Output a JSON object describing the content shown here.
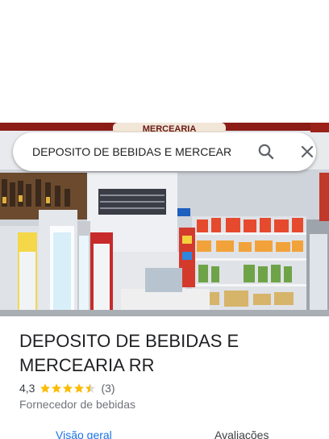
{
  "search": {
    "query": "DEPOSITO DE BEBIDAS E MERCEAR"
  },
  "photo": {
    "sign_text": "MERCEARIA"
  },
  "place": {
    "title": "DEPOSITO DE BEBIDAS E MERCEARIA RR",
    "rating": "4,3",
    "stars": 4.3,
    "review_count": "(3)",
    "category": "Fornecedor de bebidas"
  },
  "tabs": [
    {
      "label": "Visão geral"
    },
    {
      "label": "Avaliações"
    }
  ],
  "colors": {
    "star": "#fbbc04",
    "accent": "#1a73e8",
    "text": "#202124"
  },
  "icons": [
    "search-icon",
    "close-icon",
    "star-icon"
  ]
}
